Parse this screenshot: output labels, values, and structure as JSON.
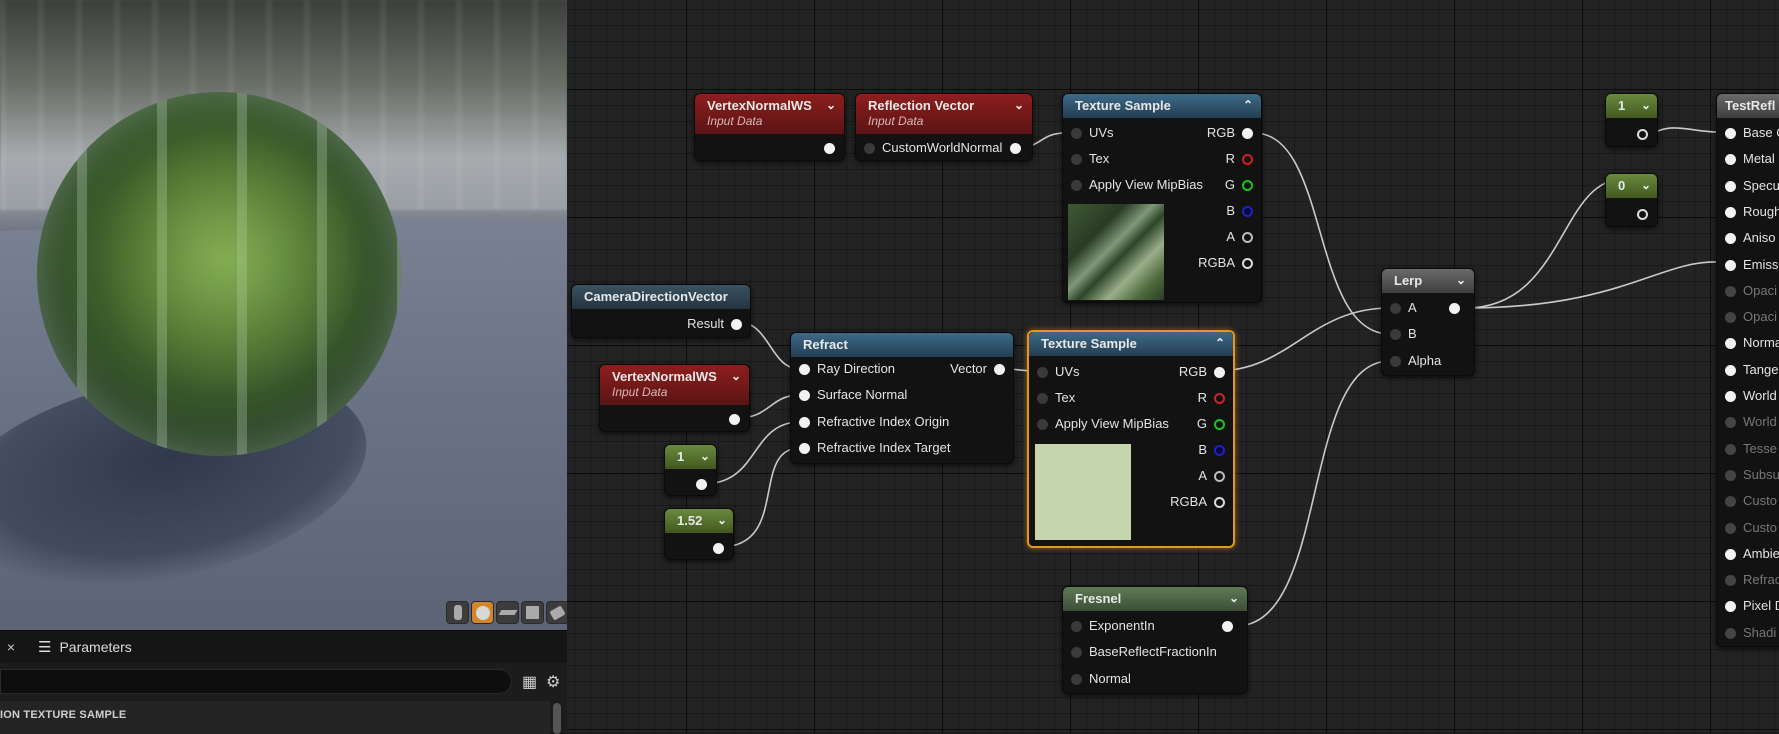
{
  "viewport": {
    "toolbar": [
      "cylinder-icon",
      "sphere-icon",
      "plane-icon",
      "cube-icon",
      "custom-mesh-icon"
    ]
  },
  "details": {
    "close_glyph": "×",
    "tab_label": "Parameters",
    "section_label": "ION TEXTURE SAMPLE"
  },
  "nodes": {
    "vnws1": {
      "title": "VertexNormalWS",
      "subtitle": "Input Data"
    },
    "reflect": {
      "title": "Reflection Vector",
      "subtitle": "Input Data",
      "pin_in": "CustomWorldNormal"
    },
    "tex1": {
      "title": "Texture Sample",
      "pins_in": [
        "UVs",
        "Tex",
        "Apply View MipBias"
      ],
      "pins_out": [
        "RGB",
        "R",
        "G",
        "B",
        "A",
        "RGBA"
      ]
    },
    "camdir": {
      "title": "CameraDirectionVector",
      "pin_out": "Result"
    },
    "refract": {
      "title": "Refract",
      "pins_in": [
        "Ray Direction",
        "Surface Normal",
        "Refractive Index Origin",
        "Refractive Index Target"
      ],
      "pin_out": "Vector"
    },
    "vnws2": {
      "title": "VertexNormalWS",
      "subtitle": "Input Data"
    },
    "const1": {
      "value": "1"
    },
    "const152": {
      "value": "1.52"
    },
    "tex2": {
      "title": "Texture Sample",
      "pins_in": [
        "UVs",
        "Tex",
        "Apply View MipBias"
      ],
      "pins_out": [
        "RGB",
        "R",
        "G",
        "B",
        "A",
        "RGBA"
      ],
      "preview_color": "#c5d6ae"
    },
    "fresnel": {
      "title": "Fresnel",
      "pins_in": [
        "ExponentIn",
        "BaseReflectFractionIn",
        "Normal"
      ]
    },
    "lerp": {
      "title": "Lerp",
      "pins_in": [
        "A",
        "B",
        "Alpha"
      ]
    },
    "constA": {
      "value": "1"
    },
    "constB": {
      "value": "0"
    },
    "result": {
      "title": "TestRefl",
      "pins": [
        {
          "label": "Base C",
          "active": true
        },
        {
          "label": "Metal",
          "active": true
        },
        {
          "label": "Specu",
          "active": true
        },
        {
          "label": "Rough",
          "active": true
        },
        {
          "label": "Aniso",
          "active": true
        },
        {
          "label": "Emiss",
          "active": true
        },
        {
          "label": "Opaci",
          "active": false
        },
        {
          "label": "Opaci",
          "active": false
        },
        {
          "label": "Norma",
          "active": true
        },
        {
          "label": "Tange",
          "active": true
        },
        {
          "label": "World",
          "active": true
        },
        {
          "label": "World",
          "active": false
        },
        {
          "label": "Tesse",
          "active": false
        },
        {
          "label": "Subsu",
          "active": false
        },
        {
          "label": "Custo",
          "active": false
        },
        {
          "label": "Custo",
          "active": false
        },
        {
          "label": "Ambie",
          "active": true
        },
        {
          "label": "Refrac",
          "active": false
        },
        {
          "label": "Pixel D",
          "active": true
        },
        {
          "label": "Shadi",
          "active": false
        }
      ]
    }
  }
}
